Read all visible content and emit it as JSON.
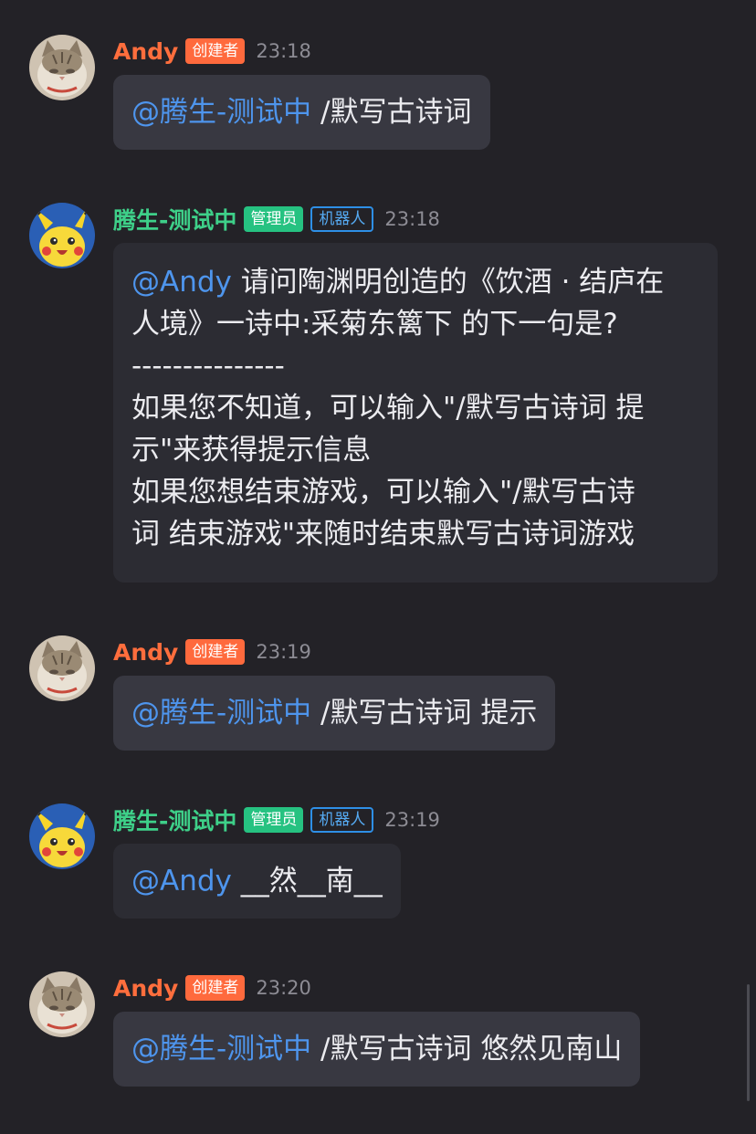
{
  "messages": [
    {
      "author": "Andy",
      "badge": "创建者",
      "time": "23:18",
      "mention": "@腾生-测试中",
      "text": " /默写古诗词"
    },
    {
      "author": "腾生-测试中",
      "badge_admin": "管理员",
      "badge_robot": "机器人",
      "time": "23:18",
      "mention": "@Andy",
      "lines": [
        "  请问陶渊明创造的《饮酒 · 结庐在",
        "人境》一诗中:采菊东篱下 的下一句是?",
        "---------------",
        "如果您不知道，可以输入\"/默写古诗词 提",
        "示\"来获得提示信息",
        "如果您想结束游戏，可以输入\"/默写古诗",
        "词 结束游戏\"来随时结束默写古诗词游戏"
      ]
    },
    {
      "author": "Andy",
      "badge": "创建者",
      "time": "23:19",
      "mention": "@腾生-测试中",
      "text": " /默写古诗词 提示"
    },
    {
      "author": "腾生-测试中",
      "badge_admin": "管理员",
      "badge_robot": "机器人",
      "time": "23:19",
      "mention": "@Andy",
      "text": " __然__南__"
    },
    {
      "author": "Andy",
      "badge": "创建者",
      "time": "23:20",
      "mention": "@腾生-测试中",
      "text": " /默写古诗词 悠然见南山"
    }
  ],
  "icons": {
    "user_avatar": "cat-avatar-icon",
    "bot_avatar": "pikachu-avatar-icon"
  },
  "colors": {
    "background": "#232227",
    "user_name": "#ff6e3d",
    "bot_name": "#3ed089",
    "mention": "#4e95ed",
    "creator_badge": "#ff6a3d",
    "admin_badge": "#26c281",
    "robot_badge": "#2e8fe6"
  }
}
